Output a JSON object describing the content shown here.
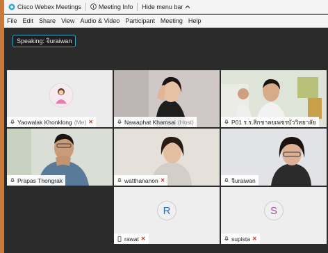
{
  "titlebar": {
    "app_title": "Cisco Webex Meetings",
    "meeting_info": "Meeting Info",
    "hide_menu": "Hide menu bar"
  },
  "menu": {
    "file": "File",
    "edit": "Edit",
    "share": "Share",
    "view": "View",
    "audio_video": "Audio & Video",
    "participant": "Participant",
    "meeting": "Meeting",
    "help": "Help"
  },
  "speaking": "Speaking: จิuraiwan",
  "participants": [
    {
      "name": "Yaowalak Khonklong",
      "role": "(Me)",
      "muted": true
    },
    {
      "name": "Nawaphat Khamsai",
      "role": "(Host)",
      "muted": false
    },
    {
      "name": "P01 ร.ร.สิกขาลยเพชรบัววิทยาลัย",
      "role": "",
      "muted": false
    },
    {
      "name": "Prapas Thongrak",
      "role": "",
      "muted": false
    },
    {
      "name": "watthananon",
      "role": "",
      "muted": true
    },
    {
      "name": "จิuraiwan",
      "role": "",
      "muted": false
    },
    {
      "name": "rawat",
      "role": "",
      "muted": true,
      "avatar": "R"
    },
    {
      "name": "supista",
      "role": "",
      "muted": true,
      "avatar": "S"
    }
  ],
  "colors": {
    "active_border": "#3aa7c4",
    "mute": "#d03030",
    "avatar_r": "#2f6fb5",
    "avatar_s": "#a34fa0"
  }
}
